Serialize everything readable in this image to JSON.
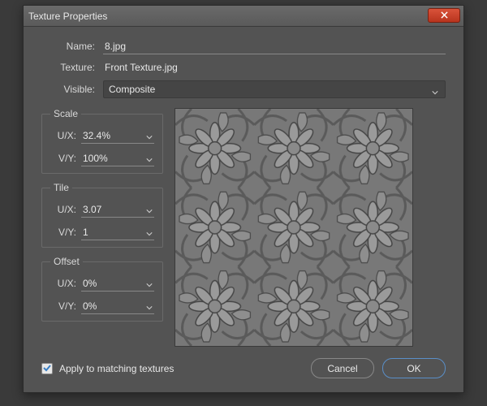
{
  "title": "Texture Properties",
  "fields": {
    "name": {
      "label": "Name:",
      "value": "8.jpg"
    },
    "texture": {
      "label": "Texture:",
      "value": "Front Texture.jpg"
    },
    "visible": {
      "label": "Visible:",
      "value": "Composite"
    }
  },
  "groups": {
    "scale": {
      "legend": "Scale",
      "ux_label": "U/X:",
      "ux_value": "32.4%",
      "vy_label": "V/Y:",
      "vy_value": "100%"
    },
    "tile": {
      "legend": "Tile",
      "ux_label": "U/X:",
      "ux_value": "3.07",
      "vy_label": "V/Y:",
      "vy_value": "1"
    },
    "offset": {
      "legend": "Offset",
      "ux_label": "U/X:",
      "ux_value": "0%",
      "vy_label": "V/Y:",
      "vy_value": "0%"
    }
  },
  "apply_label": "Apply to matching textures",
  "apply_checked": true,
  "buttons": {
    "cancel": "Cancel",
    "ok": "OK"
  }
}
